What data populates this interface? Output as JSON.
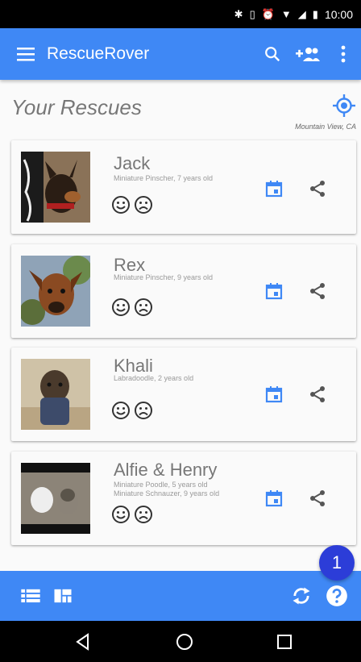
{
  "status_bar": {
    "time": "10:00"
  },
  "app_bar": {
    "title": "RescueRover"
  },
  "header": {
    "title": "Your Rescues",
    "location": "Mountain View, CA"
  },
  "rescues": [
    {
      "name": "Jack",
      "details": [
        "Miniature Pinscher, 7 years old"
      ]
    },
    {
      "name": "Rex",
      "details": [
        "Miniature Pinscher, 9 years old"
      ]
    },
    {
      "name": "Khali",
      "details": [
        "Labradoodle, 2 years old"
      ]
    },
    {
      "name": "Alfie & Henry",
      "details": [
        "Miniature Poodle, 5 years old",
        "Miniature Schnauzer, 9 years old"
      ]
    }
  ],
  "badge": {
    "count": "1"
  },
  "colors": {
    "primary": "#3f88f5",
    "badge": "#2c3dd8"
  },
  "icons": [
    "menu-icon",
    "search-icon",
    "add-people-icon",
    "more-vert-icon",
    "my-location-icon",
    "smile-icon",
    "sad-icon",
    "calendar-icon",
    "share-icon",
    "list-view-icon",
    "dashboard-view-icon",
    "sync-icon",
    "help-icon",
    "back-icon",
    "home-icon",
    "recents-icon"
  ]
}
